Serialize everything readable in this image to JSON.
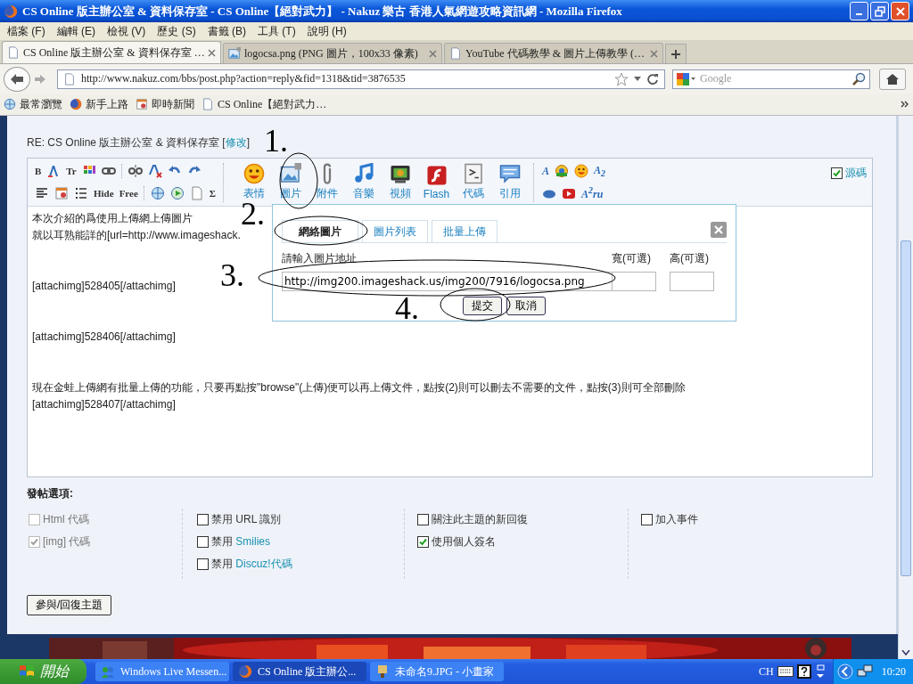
{
  "window": {
    "title": "CS Online 版主辦公室 & 資料保存室 - CS Online【絕對武力】 - Nakuz 樂古 香港人氣網遊攻略資訊網 - Mozilla Firefox"
  },
  "menu": [
    "檔案 (F)",
    "編輯 (E)",
    "檢視 (V)",
    "歷史 (S)",
    "書籤 (B)",
    "工具 (T)",
    "說明 (H)"
  ],
  "tabs": [
    {
      "label": "CS Online 版主辦公室 & 資料保存室 …",
      "selected": true
    },
    {
      "label": "logocsa.png (PNG 圖片，100x33 像素)",
      "selected": false
    },
    {
      "label": "YouTube 代碼教學 & 圖片上傳教學 (…",
      "selected": false
    }
  ],
  "address": "http://www.nakuz.com/bbs/post.php?action=reply&fid=1318&tid=3876535",
  "search": {
    "placeholder": "Google"
  },
  "bookmarks": [
    "最常瀏覽",
    "新手上路",
    "即時新聞",
    "CS Online【絕對武力…"
  ],
  "subject": {
    "text": "RE: CS Online 版主辦公室 & 資料保存室 [",
    "link": "修改",
    "suffix": "]"
  },
  "format_rows": [
    [
      {
        "kind": "letter",
        "label": "B"
      },
      {
        "kind": "icon"
      },
      {
        "kind": "letter",
        "label": "Tr"
      },
      {
        "kind": "icon"
      },
      {
        "kind": "icon"
      },
      {
        "kind": "separator"
      },
      {
        "kind": "icon"
      },
      {
        "kind": "icon"
      },
      {
        "kind": "icon"
      },
      {
        "kind": "icon"
      }
    ],
    [
      {
        "kind": "icon"
      },
      {
        "kind": "icon"
      },
      {
        "kind": "icon"
      },
      {
        "kind": "letter",
        "label": "Hide"
      },
      {
        "kind": "letter",
        "label": "Free"
      },
      {
        "kind": "separator"
      },
      {
        "kind": "icon"
      },
      {
        "kind": "icon"
      },
      {
        "kind": "icon"
      },
      {
        "kind": "letter",
        "label": "Σ"
      }
    ]
  ],
  "insert_buttons": [
    "表情",
    "圖片",
    "附件",
    "音樂",
    "視頻",
    "Flash",
    "代碼",
    "引用"
  ],
  "extra_rows": [
    [
      {
        "kind": "letter",
        "label": "A"
      },
      {
        "kind": "icon"
      },
      {
        "kind": "icon"
      },
      {
        "kind": "letter",
        "label": "A$_{2}$"
      }
    ],
    [
      {
        "kind": "icon"
      },
      {
        "kind": "icon"
      },
      {
        "kind": "letter",
        "label": "A$^{2}$ru"
      }
    ]
  ],
  "source_mode": {
    "label": "源碼",
    "checked": true
  },
  "content": [
    [
      "本次介紹的爲使用上傳網上傳圖片",
      "就以耳熟能詳的[url=http://www.imageshack."
    ],
    [
      "[attachimg]528405[/attachimg]"
    ],
    [
      "[attachimg]528406[/attachimg]"
    ],
    [
      "現在金蛙上傳網有批量上傳的功能，只要再點按\"browse\"(上傳)便可以再上傳文件，點按(2)則可以刪去不需要的文件，點按(3)則可全部刪除",
      "[attachimg]528407[/attachimg]"
    ]
  ],
  "image_dialog": {
    "tabs": [
      {
        "label": "網絡圖片",
        "selected": true
      },
      {
        "label": "圖片列表",
        "selected": false
      },
      {
        "label": "批量上傳",
        "selected": false
      }
    ],
    "url_label": "請輸入圖片地址",
    "width_label": "寬(可選)",
    "height_label": "高(可選)",
    "url_value": "http://img200.imageshack.us/img200/7916/logocsa.png",
    "buttons": [
      "提交",
      "取消"
    ]
  },
  "annotations": [
    "1.",
    "2.",
    "3.",
    "4."
  ],
  "options": {
    "title": "發帖選項:",
    "columns": [
      [
        {
          "label": "Html 代碼",
          "checked": false,
          "disabled": true
        },
        {
          "label": "[img] 代碼",
          "checked": true,
          "disabled": true
        }
      ],
      [
        {
          "label": "禁用 URL 識別",
          "checked": false,
          "disabled": false
        },
        {
          "label": "禁用 ",
          "link": "Smilies",
          "checked": false,
          "disabled": false
        },
        {
          "label": "禁用 ",
          "link": "Discuz!代碼",
          "checked": false,
          "disabled": false
        }
      ],
      [
        {
          "label": "關注此主題的新回復",
          "checked": false,
          "disabled": false
        },
        {
          "label": "使用個人簽名",
          "checked": true,
          "disabled": false
        }
      ],
      [
        {
          "label": "加入事件",
          "checked": false,
          "disabled": false
        }
      ]
    ]
  },
  "submit": "參與/回復主題",
  "taskbar": {
    "start": "開始",
    "tasks": [
      {
        "label": "Windows Live Messen...",
        "selected": false
      },
      {
        "label": "CS Online 版主辦公...",
        "selected": true
      },
      {
        "label": "未命名9.JPG - 小畫家",
        "selected": false
      }
    ],
    "language": "CH",
    "clock": "10:20"
  }
}
